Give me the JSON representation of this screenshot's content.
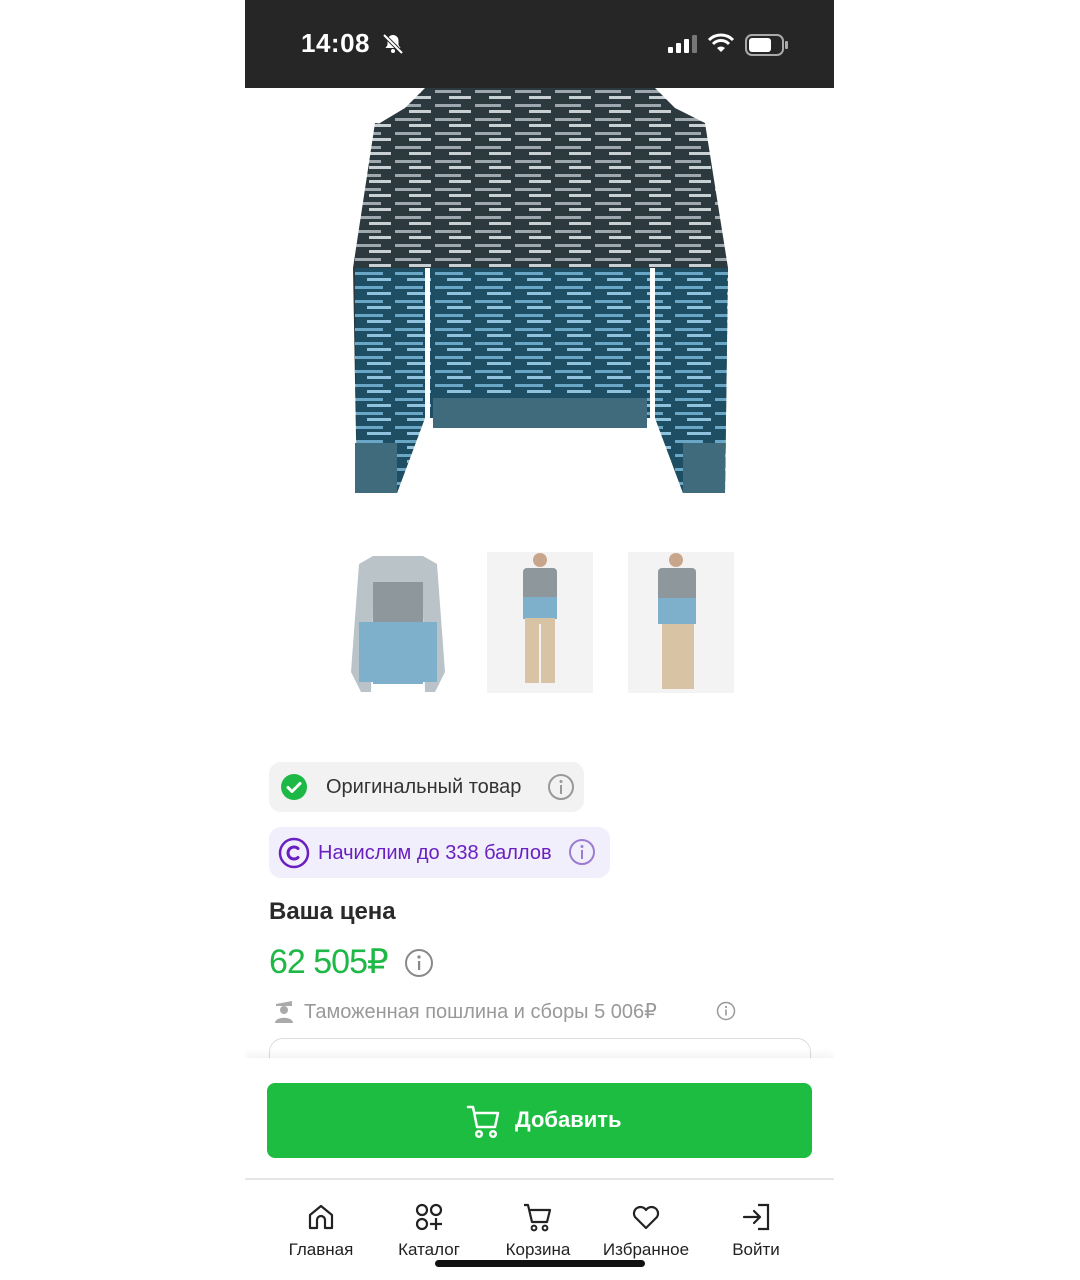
{
  "status_bar": {
    "time": "14:08"
  },
  "product": {
    "image_main": "knit-sweater-striped",
    "thumbnails": [
      "thumbnail-front",
      "thumbnail-model-front",
      "thumbnail-model-side"
    ]
  },
  "badges": {
    "original": {
      "label": "Оригинальный товар",
      "icon": "check-circle-icon"
    },
    "points": {
      "label": "Начислим до 338 баллов",
      "icon": "coin-icon"
    }
  },
  "price": {
    "title": "Ваша цена",
    "value": "62 505₽",
    "customs_text": "Таможенная пошлина и сборы 5 006₽"
  },
  "actions": {
    "add_label": "Добавить"
  },
  "nav": {
    "items": [
      {
        "label": "Главная",
        "icon": "home-icon"
      },
      {
        "label": "Каталог",
        "icon": "catalog-icon"
      },
      {
        "label": "Корзина",
        "icon": "cart-icon"
      },
      {
        "label": "Избранное",
        "icon": "heart-icon"
      },
      {
        "label": "Войти",
        "icon": "login-icon"
      }
    ]
  },
  "colors": {
    "accent_green": "#1cbd41",
    "price_green": "#1db845",
    "points_purple": "#6a1fc0",
    "status_bar_bg": "#262626"
  }
}
